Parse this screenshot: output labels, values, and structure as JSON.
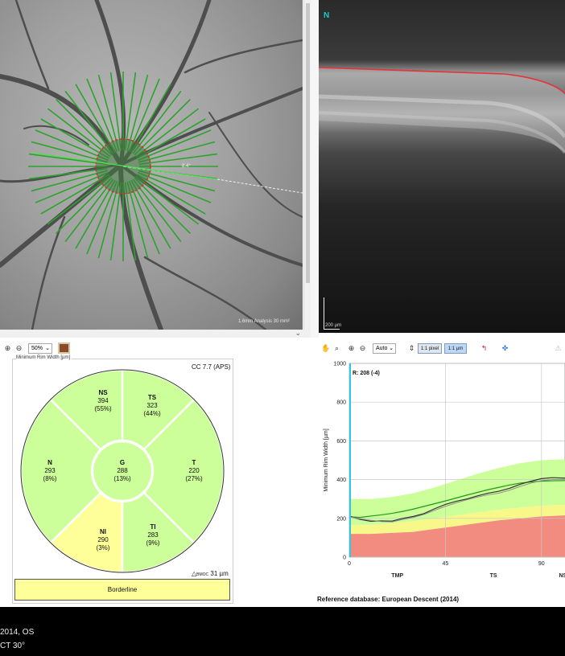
{
  "fundus": {
    "overlay_label": "1.6mm Analysis 30 mm²",
    "distance_label": "8.4°"
  },
  "oct": {
    "orientation_label": "N",
    "scale_label": "200 µm",
    "segmentation_color": "#e8313a"
  },
  "left_toolbar": {
    "zoom_value": "50%"
  },
  "rim_panel": {
    "title": "Minimum Rim Width [µm]",
    "classification_label": "CC 7.7 (APS)",
    "bmo_label_prefix": "△",
    "bmo_label_sub": "BMOC",
    "bmo_value": "31 µm",
    "overall_label": "Borderline",
    "overall_color": "#ffff99",
    "sectors": [
      {
        "id": "NS",
        "name": "NS",
        "value": "394",
        "percentile": "(55%)",
        "color": "#ccff99"
      },
      {
        "id": "TS",
        "name": "TS",
        "value": "323",
        "percentile": "(44%)",
        "color": "#ccff99"
      },
      {
        "id": "T",
        "name": "T",
        "value": "220",
        "percentile": "(27%)",
        "color": "#ccff99"
      },
      {
        "id": "TI",
        "name": "TI",
        "value": "283",
        "percentile": "(9%)",
        "color": "#ccff99"
      },
      {
        "id": "NI",
        "name": "NI",
        "value": "290",
        "percentile": "(3%)",
        "color": "#ffff99"
      },
      {
        "id": "N",
        "name": "N",
        "value": "293",
        "percentile": "(8%)",
        "color": "#ccff99"
      },
      {
        "id": "G",
        "name": "G",
        "value": "288",
        "percentile": "(13%)",
        "color": "#ccff99"
      }
    ]
  },
  "right_toolbar": {
    "scale_mode": "Auto",
    "btn_pixel": "1:1 pixel",
    "btn_um": "1:1 µm"
  },
  "chart_data": {
    "type": "line",
    "ylabel": "Minimum Rim Width [µm]",
    "yticks": [
      0,
      200,
      400,
      600,
      800,
      1000
    ],
    "ylim": [
      0,
      1000
    ],
    "xticks": [
      0,
      45,
      90
    ],
    "xlim": [
      0,
      101
    ],
    "sector_labels": [
      {
        "label": "TMP",
        "x": 22.5
      },
      {
        "label": "TS",
        "x": 67.5
      },
      {
        "label": "NS",
        "x": 100
      }
    ],
    "cursor_label": "R: 208 (-4)",
    "cursor_x": 0,
    "bands": {
      "x": [
        0,
        10,
        20,
        30,
        40,
        50,
        60,
        70,
        80,
        90,
        101
      ],
      "p1": [
        120,
        120,
        125,
        130,
        145,
        160,
        175,
        190,
        200,
        210,
        215
      ],
      "p5": [
        165,
        165,
        175,
        185,
        200,
        215,
        230,
        245,
        255,
        265,
        270
      ],
      "p95": [
        300,
        300,
        310,
        330,
        360,
        395,
        430,
        460,
        485,
        500,
        505
      ]
    },
    "series": [
      {
        "x": [
          0,
          5,
          10,
          15,
          20,
          25,
          30,
          35,
          40,
          45,
          50,
          55,
          60,
          65,
          70,
          75,
          80,
          85,
          90,
          95,
          101
        ],
        "values": [
          208,
          205,
          212,
          218,
          226,
          236,
          248,
          262,
          276,
          290,
          305,
          320,
          334,
          348,
          360,
          372,
          382,
          388,
          392,
          394,
          395
        ]
      },
      {
        "x": [
          0,
          5,
          10,
          15,
          20,
          25,
          30,
          35,
          40,
          45,
          50,
          55,
          60,
          65,
          70,
          75,
          80,
          85,
          90,
          95,
          101
        ],
        "values": [
          212,
          195,
          185,
          187,
          186,
          200,
          210,
          225,
          250,
          272,
          288,
          300,
          316,
          330,
          340,
          355,
          376,
          392,
          405,
          410,
          408
        ]
      },
      {
        "x": [
          0,
          5,
          10,
          15,
          20,
          25,
          30,
          35,
          40,
          45,
          50,
          55,
          60,
          65,
          70,
          75,
          80,
          85,
          90,
          95,
          101
        ],
        "values": [
          208,
          198,
          190,
          184,
          182,
          194,
          205,
          220,
          242,
          262,
          280,
          296,
          310,
          322,
          330,
          345,
          365,
          382,
          395,
          400,
          402
        ]
      }
    ],
    "colors": {
      "outside": "#f28c80",
      "borderline": "#f8f88a",
      "normal": "#ccff99",
      "norm_line": "#1f9a1f",
      "patient": "#333333",
      "cursor": "#2ec8e0",
      "grid": "#c8c8c8"
    }
  },
  "reference_database": "Reference database: European Descent (2014)",
  "footer": {
    "line1": "2014, OS",
    "line2": "CT 30°"
  }
}
